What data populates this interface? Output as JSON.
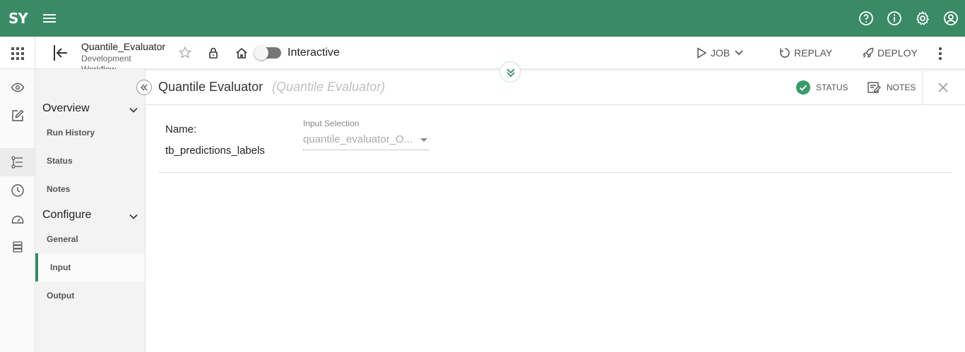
{
  "app": {
    "logo": "SY"
  },
  "flow": {
    "title": "Quantile_Evaluator",
    "subtitle": "Development",
    "subtitle2": "Workflow",
    "mode_label": "Interactive"
  },
  "actions": {
    "job": "JOB",
    "replay": "REPLAY",
    "deploy": "DEPLOY"
  },
  "sidenav": {
    "overview": {
      "label": "Overview",
      "items": [
        "Run History",
        "Status",
        "Notes"
      ]
    },
    "configure": {
      "label": "Configure",
      "items": [
        "General",
        "Input",
        "Output"
      ]
    },
    "active_item": "Input"
  },
  "panel": {
    "title": "Quantile Evaluator",
    "subtitle": "(Quantile Evaluator)",
    "status_label": "STATUS",
    "notes_label": "NOTES",
    "status_color": "#3a9a6a"
  },
  "form": {
    "name_label": "Name:",
    "name_value": "tb_predictions_labels",
    "input_selection_label": "Input Selection",
    "input_selection_value": "quantile_evaluator_O..."
  },
  "colors": {
    "brand": "#3a8a66"
  }
}
